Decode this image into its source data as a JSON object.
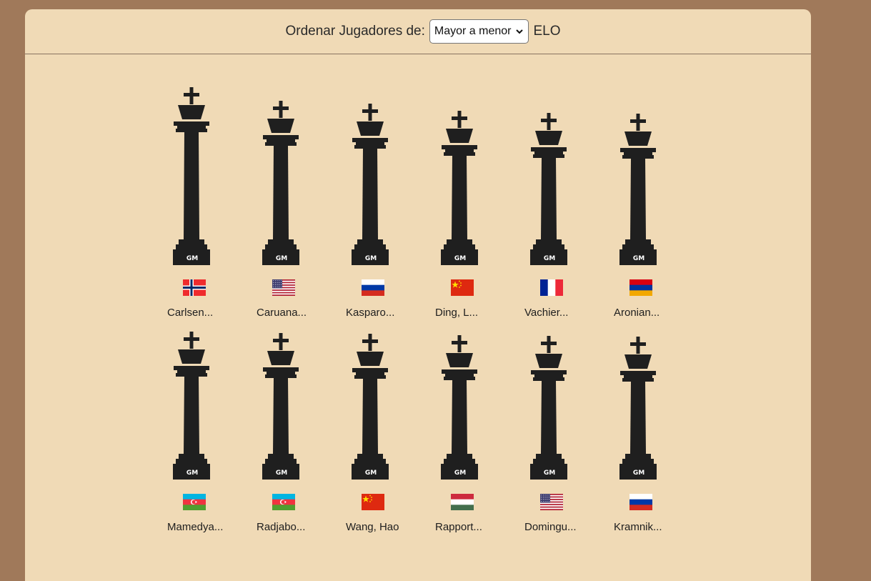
{
  "toolbar": {
    "sort_label": "Ordenar Jugadores de:",
    "sort_value": "Mayor a menor",
    "sort_suffix": "ELO"
  },
  "rows": [
    {
      "players": [
        {
          "name": "Carlsen...",
          "title": "GM",
          "flag": "norway-flag",
          "size": 1.0
        },
        {
          "name": "Caruana...",
          "title": "GM",
          "flag": "usa-flag",
          "size": 0.83
        },
        {
          "name": "Kasparo...",
          "title": "GM",
          "flag": "russia-flag",
          "size": 0.79
        },
        {
          "name": "Ding, L...",
          "title": "GM",
          "flag": "china-flag",
          "size": 0.7
        },
        {
          "name": "Vachier...",
          "title": "GM",
          "flag": "france-flag",
          "size": 0.67
        },
        {
          "name": "Aronian...",
          "title": "GM",
          "flag": "armenia-flag",
          "size": 0.66
        }
      ]
    },
    {
      "players": [
        {
          "name": "Mamedya...",
          "title": "GM",
          "flag": "azerbaijan-flag",
          "size": 0.62
        },
        {
          "name": "Radjabo...",
          "title": "GM",
          "flag": "azerbaijan-flag",
          "size": 0.6
        },
        {
          "name": "Wang, Hao",
          "title": "GM",
          "flag": "china-flag",
          "size": 0.59
        },
        {
          "name": "Rapport...",
          "title": "GM",
          "flag": "hungary-flag",
          "size": 0.57
        },
        {
          "name": "Domingu...",
          "title": "GM",
          "flag": "usa-flag",
          "size": 0.56
        },
        {
          "name": "Kramnik...",
          "title": "GM",
          "flag": "russia-flag",
          "size": 0.55
        }
      ]
    }
  ],
  "colors": {
    "piece": "#1f1f1f",
    "background": "#a0795a",
    "panel": "#f0dab6"
  }
}
